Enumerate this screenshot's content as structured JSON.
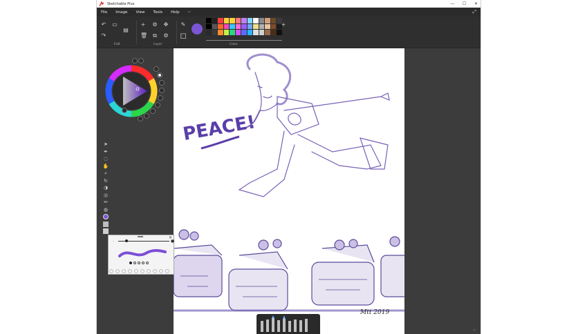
{
  "window": {
    "title": "Sketchable Plus",
    "minimize": "—",
    "maximize": "☐",
    "close": "✕"
  },
  "menu": {
    "items": [
      "File",
      "Image",
      "View",
      "Tools",
      "Help"
    ],
    "more": "⌵"
  },
  "toolbar": {
    "groups": {
      "edit": "Edit",
      "layer": "Layer",
      "color": "Color"
    },
    "current_color": "#7b55d6",
    "palette": [
      "#000000",
      "#222222",
      "#ff3b3b",
      "#ffd43b",
      "#ffd43b",
      "#ff7a7a",
      "#c07fff",
      "#7fd6ff",
      "#ffffff",
      "#8a8a8a",
      "#d2a07a",
      "#6b4a2b",
      "#3a3a3a",
      "#000000",
      "#555555",
      "#ff6a2b",
      "#ff47b5",
      "#38c6ff",
      "#ff6bd6",
      "#9b5cff",
      "#6fa8ff",
      "#f0e08a",
      "#b0b0b0",
      "#e6c3a0",
      "#804a28",
      "#1b1b1b",
      "#2a2a2a",
      "#3a3a3a",
      "#ff8c2b",
      "#c7f048",
      "#2bd67e",
      "#d64fff",
      "#5c6bff",
      "#2bb4ff",
      "#e0e0e0",
      "#cfcfcf",
      "#9a6a4a",
      "#4a2e1a",
      "#101010"
    ],
    "add_color": "+"
  },
  "doodle_text": "PEACE!",
  "signature": "Mtt 2019",
  "icons": {
    "expand": "⤢",
    "scroll_down": "⌄"
  }
}
